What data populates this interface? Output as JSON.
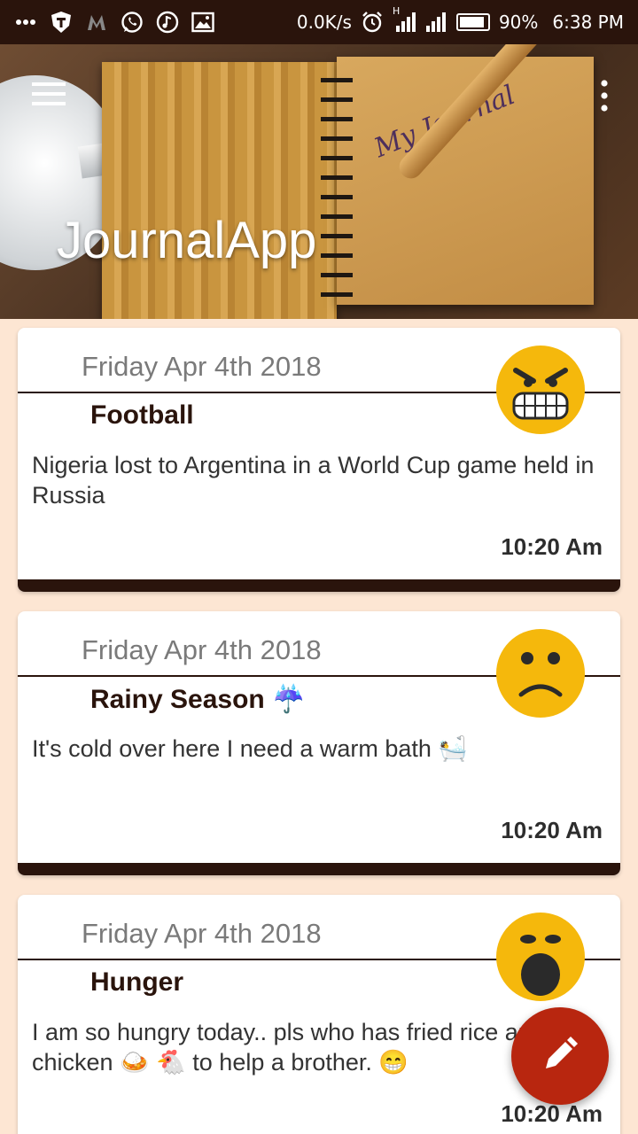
{
  "status_bar": {
    "network_speed": "0.0K/s",
    "battery": "90%",
    "battery_level": 0.9,
    "time": "6:38 PM",
    "signal_type": "H",
    "left_icons": [
      "more-dots-icon",
      "vpn-shield-icon",
      "mi-icon",
      "whatsapp-icon",
      "music-icon",
      "gallery-icon"
    ]
  },
  "header": {
    "title": "JournalApp",
    "image_caption": "My Journal",
    "menu_icon": "hamburger-menu-icon",
    "overflow_icon": "overflow-menu-icon"
  },
  "entries": [
    {
      "date": "Friday Apr 4th 2018",
      "title": "Football",
      "body": "Nigeria lost to Argentina in a World Cup game held in Russia",
      "time": "10:20 Am",
      "mood": "angry-face-icon"
    },
    {
      "date": "Friday Apr 4th 2018",
      "title": "Rainy Season ☔",
      "body": "It's cold over here I need a warm bath 🛀",
      "time": "10:20 Am",
      "mood": "sad-face-icon"
    },
    {
      "date": "Friday Apr 4th 2018",
      "title": "Hunger",
      "body": "I am so hungry today..   pls who has fried rice and chicken 🍛 🐔  to help a brother.  😁",
      "time": "10:20 Am",
      "mood": "surprised-face-icon"
    }
  ],
  "fab": {
    "icon": "edit-pencil-icon"
  },
  "colors": {
    "primary_dark": "#2a140c",
    "background": "#fde6d3",
    "accent": "#b8260f",
    "mood_yellow": "#f5b80c"
  }
}
